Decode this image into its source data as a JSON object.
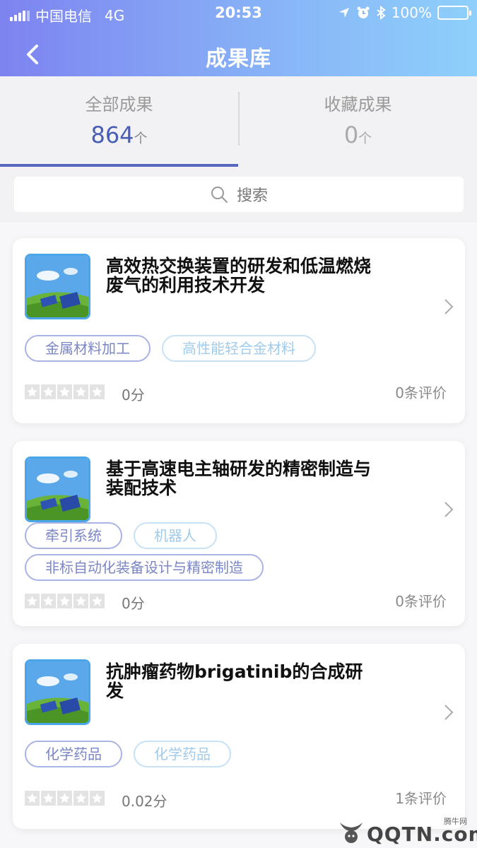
{
  "status": {
    "carrier": "中国电信",
    "network": "4G",
    "time": "20:53",
    "battery": "100%"
  },
  "nav": {
    "title": "成果库"
  },
  "tabs": [
    {
      "label": "全部成果",
      "count": "864",
      "unit": "个"
    },
    {
      "label": "收藏成果",
      "count": "0",
      "unit": "个"
    }
  ],
  "search": {
    "placeholder": "搜索"
  },
  "cards": [
    {
      "title": "高效热交换装置的研发和低温燃烧废气的利用技术开发",
      "tags": [
        "金属材料加工",
        "高性能轻合金材料"
      ],
      "score": "0分",
      "reviews": "0条评价"
    },
    {
      "title": "基于高速电主轴研发的精密制造与装配技术",
      "tags": [
        "牵引系统",
        "机器人",
        "非标自动化装备设计与精密制造"
      ],
      "score": "0分",
      "reviews": "0条评价"
    },
    {
      "title": "抗肿瘤药物brigatinib的合成研发",
      "tags": [
        "化学药品",
        "化学药品"
      ],
      "score": "0.02分",
      "reviews": "1条评价"
    }
  ],
  "watermark": {
    "text": "QQTN.com",
    "small": "腾牛网"
  },
  "colors": {
    "accent": "#5866c0",
    "header_start": "#7d83f0",
    "header_end": "#8ed0fb"
  }
}
